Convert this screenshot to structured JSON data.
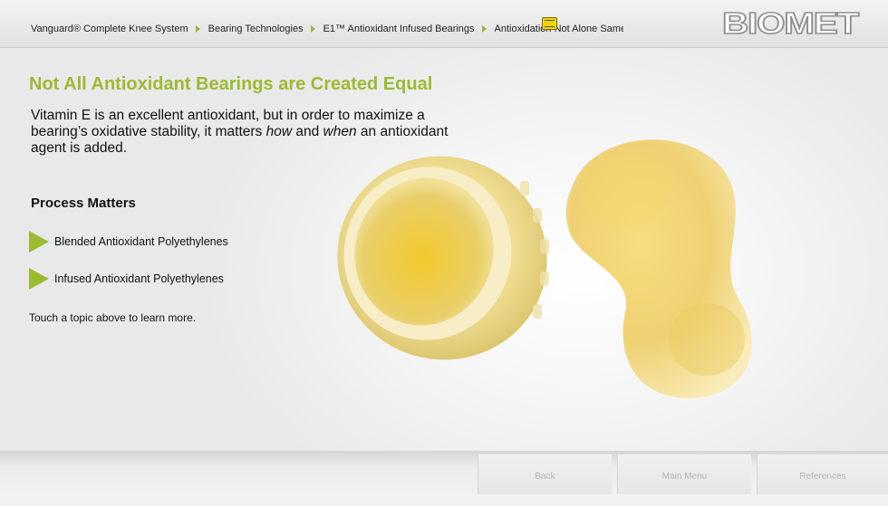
{
  "breadcrumb": {
    "items": [
      "Vanguard® Complete Knee System",
      "Bearing Technologies",
      "E1™ Antioxidant Infused Bearings",
      "Antioxidation Not Alone Same"
    ]
  },
  "brand": {
    "logo_text": "BIOMET",
    "accent": "#9cbb32"
  },
  "content": {
    "title": "Not All Antioxidant Bearings are Created Equal",
    "lead_part1": "Vitamin E is an excellent antioxidant, but in order to maximize a bearing’s oxidative stability, it matters ",
    "lead_em1": "how",
    "lead_part2": " and ",
    "lead_em2": "when",
    "lead_part3": " an antioxidant agent is added.",
    "section_heading": "Process Matters",
    "topics": [
      "Blended Antioxidant Polyethylenes",
      "Infused Antioxidant Polyethylenes"
    ],
    "hint": "Touch a topic above to learn more."
  },
  "footer": {
    "back": "Back",
    "main_menu": "Main Menu",
    "references": "References"
  },
  "icons": {
    "note": "note-icon",
    "topic_arrow": "play-arrow-icon"
  }
}
